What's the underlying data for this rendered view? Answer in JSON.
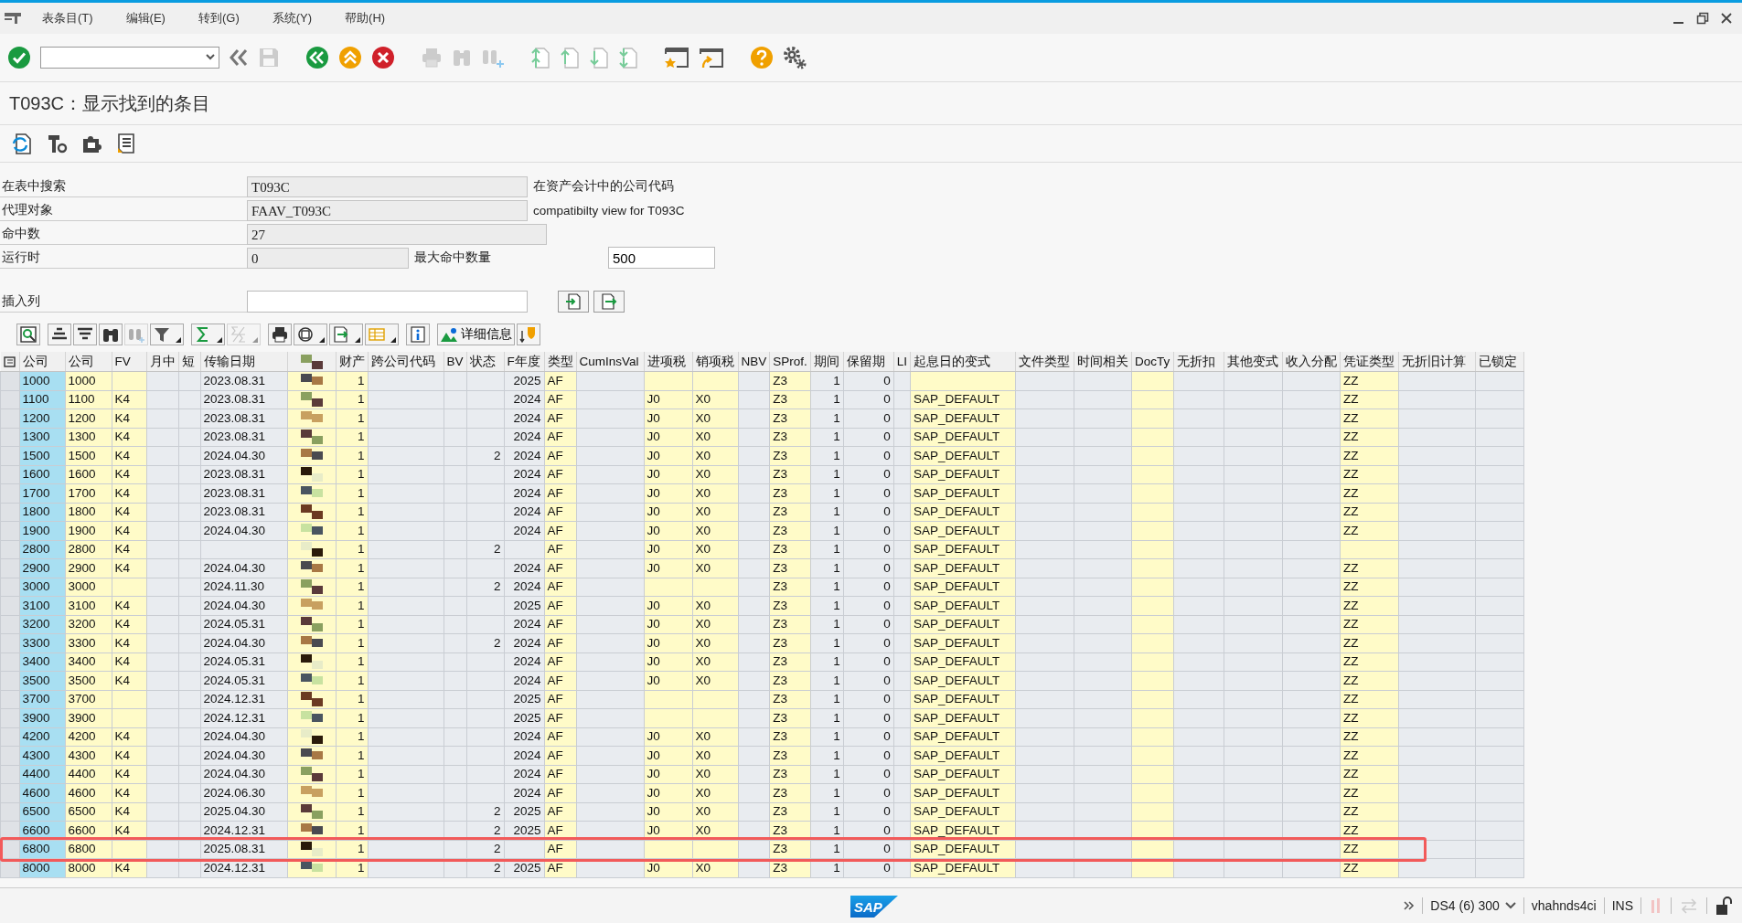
{
  "menu": [
    {
      "label": "表条目(T)"
    },
    {
      "label": "编辑(E)"
    },
    {
      "label": "转到(G)"
    },
    {
      "label": "系统(Y)"
    },
    {
      "label": "帮助(H)"
    }
  ],
  "title": "T093C：显示找到的条目",
  "form": [
    {
      "label": "在表中搜索",
      "value": "T093C",
      "description": "在资产会计中的公司代码"
    },
    {
      "label": "代理对象",
      "value": "FAAV_T093C",
      "description": "compatibilty view for T093C"
    },
    {
      "label": "命中数",
      "value": "27"
    },
    {
      "label": "运行时",
      "value": "0",
      "extra_label": "最大命中数量",
      "extra_value": "500"
    }
  ],
  "insert_column": {
    "label": "插入列"
  },
  "alv_toolbar": {
    "details_button": "详细信息"
  },
  "table": {
    "columns": [
      {
        "kind": "selector"
      },
      {
        "label": "公司",
        "kind": "key"
      },
      {
        "label": "公司",
        "kind": "input"
      },
      {
        "label": "FV",
        "kind": "input"
      },
      {
        "label": "月中",
        "kind": "plain"
      },
      {
        "label": "短",
        "kind": "plain"
      },
      {
        "label": "传输日期",
        "kind": "plain"
      },
      {
        "kind": "redacted"
      },
      {
        "label": "财产",
        "kind": "input"
      },
      {
        "label": "跨公司代码",
        "kind": "plain"
      },
      {
        "label": "BV",
        "kind": "plain"
      },
      {
        "label": "状态",
        "kind": "plain"
      },
      {
        "label": "F年度",
        "kind": "plain"
      },
      {
        "label": "类型",
        "kind": "input"
      },
      {
        "label": "CumInsVal",
        "kind": "plain"
      },
      {
        "label": "进项税",
        "kind": "input"
      },
      {
        "label": "销项税",
        "kind": "input"
      },
      {
        "label": "NBV",
        "kind": "plain"
      },
      {
        "label": "SProf.",
        "kind": "input"
      },
      {
        "label": "期间",
        "kind": "plain"
      },
      {
        "label": "保留期",
        "kind": "plain"
      },
      {
        "label": "LI",
        "kind": "plain"
      },
      {
        "label": "起息日的变式",
        "kind": "input"
      },
      {
        "label": "文件类型",
        "kind": "plain"
      },
      {
        "label": "时间相关",
        "kind": "plain"
      },
      {
        "label": "DocTy",
        "kind": "input"
      },
      {
        "label": "无折扣",
        "kind": "plain"
      },
      {
        "label": "其他变式",
        "kind": "plain"
      },
      {
        "label": "收入分配",
        "kind": "plain"
      },
      {
        "label": "凭证类型",
        "kind": "input"
      },
      {
        "label": "无折旧计算",
        "kind": "plain"
      },
      {
        "label": "已锁定",
        "kind": "plain"
      }
    ],
    "rows": [
      {
        "highlighted": false,
        "cells": [
          "",
          "1000",
          "1000",
          "",
          "",
          "",
          "2023.08.31",
          "",
          "1",
          "",
          "",
          "",
          "2025",
          "AF",
          "",
          "",
          "",
          "",
          "Z3",
          "1",
          "0",
          "",
          "",
          "",
          "",
          "",
          "",
          "",
          "",
          "ZZ",
          "",
          ""
        ]
      },
      {
        "highlighted": false,
        "cells": [
          "",
          "1100",
          "1100",
          "K4",
          "",
          "",
          "2023.08.31",
          "",
          "1",
          "",
          "",
          "",
          "2024",
          "AF",
          "",
          "J0",
          "X0",
          "",
          "Z3",
          "1",
          "0",
          "",
          "SAP_DEFAULT",
          "",
          "",
          "",
          "",
          "",
          "",
          "ZZ",
          "",
          ""
        ]
      },
      {
        "highlighted": false,
        "cells": [
          "",
          "1200",
          "1200",
          "K4",
          "",
          "",
          "2023.08.31",
          "",
          "1",
          "",
          "",
          "",
          "2024",
          "AF",
          "",
          "J0",
          "X0",
          "",
          "Z3",
          "1",
          "0",
          "",
          "SAP_DEFAULT",
          "",
          "",
          "",
          "",
          "",
          "",
          "ZZ",
          "",
          ""
        ]
      },
      {
        "highlighted": false,
        "cells": [
          "",
          "1300",
          "1300",
          "K4",
          "",
          "",
          "2023.08.31",
          "",
          "1",
          "",
          "",
          "",
          "2024",
          "AF",
          "",
          "J0",
          "X0",
          "",
          "Z3",
          "1",
          "0",
          "",
          "SAP_DEFAULT",
          "",
          "",
          "",
          "",
          "",
          "",
          "ZZ",
          "",
          ""
        ]
      },
      {
        "highlighted": false,
        "cells": [
          "",
          "1500",
          "1500",
          "K4",
          "",
          "",
          "2024.04.30",
          "",
          "1",
          "",
          "",
          "2",
          "2024",
          "AF",
          "",
          "J0",
          "X0",
          "",
          "Z3",
          "1",
          "0",
          "",
          "SAP_DEFAULT",
          "",
          "",
          "",
          "",
          "",
          "",
          "ZZ",
          "",
          ""
        ]
      },
      {
        "highlighted": false,
        "cells": [
          "",
          "1600",
          "1600",
          "K4",
          "",
          "",
          "2023.08.31",
          "",
          "1",
          "",
          "",
          "",
          "2024",
          "AF",
          "",
          "J0",
          "X0",
          "",
          "Z3",
          "1",
          "0",
          "",
          "SAP_DEFAULT",
          "",
          "",
          "",
          "",
          "",
          "",
          "ZZ",
          "",
          ""
        ]
      },
      {
        "highlighted": false,
        "cells": [
          "",
          "1700",
          "1700",
          "K4",
          "",
          "",
          "2023.08.31",
          "",
          "1",
          "",
          "",
          "",
          "2024",
          "AF",
          "",
          "J0",
          "X0",
          "",
          "Z3",
          "1",
          "0",
          "",
          "SAP_DEFAULT",
          "",
          "",
          "",
          "",
          "",
          "",
          "ZZ",
          "",
          ""
        ]
      },
      {
        "highlighted": false,
        "cells": [
          "",
          "1800",
          "1800",
          "K4",
          "",
          "",
          "2023.08.31",
          "",
          "1",
          "",
          "",
          "",
          "2024",
          "AF",
          "",
          "J0",
          "X0",
          "",
          "Z3",
          "1",
          "0",
          "",
          "SAP_DEFAULT",
          "",
          "",
          "",
          "",
          "",
          "",
          "ZZ",
          "",
          ""
        ]
      },
      {
        "highlighted": false,
        "cells": [
          "",
          "1900",
          "1900",
          "K4",
          "",
          "",
          "2024.04.30",
          "",
          "1",
          "",
          "",
          "",
          "2024",
          "AF",
          "",
          "J0",
          "X0",
          "",
          "Z3",
          "1",
          "0",
          "",
          "SAP_DEFAULT",
          "",
          "",
          "",
          "",
          "",
          "",
          "ZZ",
          "",
          ""
        ]
      },
      {
        "highlighted": false,
        "cells": [
          "",
          "2800",
          "2800",
          "K4",
          "",
          "",
          "",
          "",
          "1",
          "",
          "",
          "2",
          "",
          "AF",
          "",
          "J0",
          "X0",
          "",
          "Z3",
          "1",
          "0",
          "",
          "SAP_DEFAULT",
          "",
          "",
          "",
          "",
          "",
          "",
          "",
          "",
          ""
        ]
      },
      {
        "highlighted": false,
        "cells": [
          "",
          "2900",
          "2900",
          "K4",
          "",
          "",
          "2024.04.30",
          "",
          "1",
          "",
          "",
          "",
          "2024",
          "AF",
          "",
          "J0",
          "X0",
          "",
          "Z3",
          "1",
          "0",
          "",
          "SAP_DEFAULT",
          "",
          "",
          "",
          "",
          "",
          "",
          "ZZ",
          "",
          ""
        ]
      },
      {
        "highlighted": false,
        "cells": [
          "",
          "3000",
          "3000",
          "",
          "",
          "",
          "2024.11.30",
          "",
          "1",
          "",
          "",
          "2",
          "2024",
          "AF",
          "",
          "",
          "",
          "",
          "Z3",
          "1",
          "0",
          "",
          "SAP_DEFAULT",
          "",
          "",
          "",
          "",
          "",
          "",
          "ZZ",
          "",
          ""
        ]
      },
      {
        "highlighted": false,
        "cells": [
          "",
          "3100",
          "3100",
          "K4",
          "",
          "",
          "2024.04.30",
          "",
          "1",
          "",
          "",
          "",
          "2025",
          "AF",
          "",
          "J0",
          "X0",
          "",
          "Z3",
          "1",
          "0",
          "",
          "SAP_DEFAULT",
          "",
          "",
          "",
          "",
          "",
          "",
          "ZZ",
          "",
          ""
        ]
      },
      {
        "highlighted": false,
        "cells": [
          "",
          "3200",
          "3200",
          "K4",
          "",
          "",
          "2024.05.31",
          "",
          "1",
          "",
          "",
          "",
          "2024",
          "AF",
          "",
          "J0",
          "X0",
          "",
          "Z3",
          "1",
          "0",
          "",
          "SAP_DEFAULT",
          "",
          "",
          "",
          "",
          "",
          "",
          "ZZ",
          "",
          ""
        ]
      },
      {
        "highlighted": false,
        "cells": [
          "",
          "3300",
          "3300",
          "K4",
          "",
          "",
          "2024.04.30",
          "",
          "1",
          "",
          "",
          "2",
          "2024",
          "AF",
          "",
          "J0",
          "X0",
          "",
          "Z3",
          "1",
          "0",
          "",
          "SAP_DEFAULT",
          "",
          "",
          "",
          "",
          "",
          "",
          "ZZ",
          "",
          ""
        ]
      },
      {
        "highlighted": false,
        "cells": [
          "",
          "3400",
          "3400",
          "K4",
          "",
          "",
          "2024.05.31",
          "",
          "1",
          "",
          "",
          "",
          "2024",
          "AF",
          "",
          "J0",
          "X0",
          "",
          "Z3",
          "1",
          "0",
          "",
          "SAP_DEFAULT",
          "",
          "",
          "",
          "",
          "",
          "",
          "ZZ",
          "",
          ""
        ]
      },
      {
        "highlighted": false,
        "cells": [
          "",
          "3500",
          "3500",
          "K4",
          "",
          "",
          "2024.05.31",
          "",
          "1",
          "",
          "",
          "",
          "2024",
          "AF",
          "",
          "J0",
          "X0",
          "",
          "Z3",
          "1",
          "0",
          "",
          "SAP_DEFAULT",
          "",
          "",
          "",
          "",
          "",
          "",
          "ZZ",
          "",
          ""
        ]
      },
      {
        "highlighted": false,
        "cells": [
          "",
          "3700",
          "3700",
          "",
          "",
          "",
          "2024.12.31",
          "",
          "1",
          "",
          "",
          "",
          "2025",
          "AF",
          "",
          "",
          "",
          "",
          "Z3",
          "1",
          "0",
          "",
          "SAP_DEFAULT",
          "",
          "",
          "",
          "",
          "",
          "",
          "ZZ",
          "",
          ""
        ]
      },
      {
        "highlighted": false,
        "cells": [
          "",
          "3900",
          "3900",
          "",
          "",
          "",
          "2024.12.31",
          "",
          "1",
          "",
          "",
          "",
          "2025",
          "AF",
          "",
          "",
          "",
          "",
          "Z3",
          "1",
          "0",
          "",
          "SAP_DEFAULT",
          "",
          "",
          "",
          "",
          "",
          "",
          "ZZ",
          "",
          ""
        ]
      },
      {
        "highlighted": false,
        "cells": [
          "",
          "4200",
          "4200",
          "K4",
          "",
          "",
          "2024.04.30",
          "",
          "1",
          "",
          "",
          "",
          "2024",
          "AF",
          "",
          "J0",
          "X0",
          "",
          "Z3",
          "1",
          "0",
          "",
          "SAP_DEFAULT",
          "",
          "",
          "",
          "",
          "",
          "",
          "ZZ",
          "",
          ""
        ]
      },
      {
        "highlighted": false,
        "cells": [
          "",
          "4300",
          "4300",
          "K4",
          "",
          "",
          "2024.04.30",
          "",
          "1",
          "",
          "",
          "",
          "2024",
          "AF",
          "",
          "J0",
          "X0",
          "",
          "Z3",
          "1",
          "0",
          "",
          "SAP_DEFAULT",
          "",
          "",
          "",
          "",
          "",
          "",
          "ZZ",
          "",
          ""
        ]
      },
      {
        "highlighted": false,
        "cells": [
          "",
          "4400",
          "4400",
          "K4",
          "",
          "",
          "2024.04.30",
          "",
          "1",
          "",
          "",
          "",
          "2024",
          "AF",
          "",
          "J0",
          "X0",
          "",
          "Z3",
          "1",
          "0",
          "",
          "SAP_DEFAULT",
          "",
          "",
          "",
          "",
          "",
          "",
          "ZZ",
          "",
          ""
        ]
      },
      {
        "highlighted": false,
        "cells": [
          "",
          "4600",
          "4600",
          "K4",
          "",
          "",
          "2024.06.30",
          "",
          "1",
          "",
          "",
          "",
          "2024",
          "AF",
          "",
          "J0",
          "X0",
          "",
          "Z3",
          "1",
          "0",
          "",
          "SAP_DEFAULT",
          "",
          "",
          "",
          "",
          "",
          "",
          "ZZ",
          "",
          ""
        ]
      },
      {
        "highlighted": false,
        "cells": [
          "",
          "6500",
          "6500",
          "K4",
          "",
          "",
          "2025.04.30",
          "",
          "1",
          "",
          "",
          "2",
          "2025",
          "AF",
          "",
          "J0",
          "X0",
          "",
          "Z3",
          "1",
          "0",
          "",
          "SAP_DEFAULT",
          "",
          "",
          "",
          "",
          "",
          "",
          "ZZ",
          "",
          ""
        ]
      },
      {
        "highlighted": false,
        "cells": [
          "",
          "6600",
          "6600",
          "K4",
          "",
          "",
          "2024.12.31",
          "",
          "1",
          "",
          "",
          "2",
          "2025",
          "AF",
          "",
          "J0",
          "X0",
          "",
          "Z3",
          "1",
          "0",
          "",
          "SAP_DEFAULT",
          "",
          "",
          "",
          "",
          "",
          "",
          "ZZ",
          "",
          ""
        ]
      },
      {
        "highlighted": true,
        "cells": [
          "",
          "6800",
          "6800",
          "",
          "",
          "",
          "2025.08.31",
          "",
          "1",
          "",
          "",
          "2",
          "",
          "AF",
          "",
          "",
          "",
          "",
          "Z3",
          "1",
          "0",
          "",
          "SAP_DEFAULT",
          "",
          "",
          "",
          "",
          "",
          "",
          "ZZ",
          "",
          ""
        ]
      },
      {
        "highlighted": false,
        "cells": [
          "",
          "8000",
          "8000",
          "K4",
          "",
          "",
          "2024.12.31",
          "",
          "1",
          "",
          "",
          "2",
          "2025",
          "AF",
          "",
          "J0",
          "X0",
          "",
          "Z3",
          "1",
          "0",
          "",
          "SAP_DEFAULT",
          "",
          "",
          "",
          "",
          "",
          "",
          "ZZ",
          "",
          ""
        ]
      }
    ]
  },
  "status_bar": {
    "system": "DS4 (6) 300",
    "server": "vhahnds4ci",
    "mode": "INS",
    "logo": "SAP"
  }
}
